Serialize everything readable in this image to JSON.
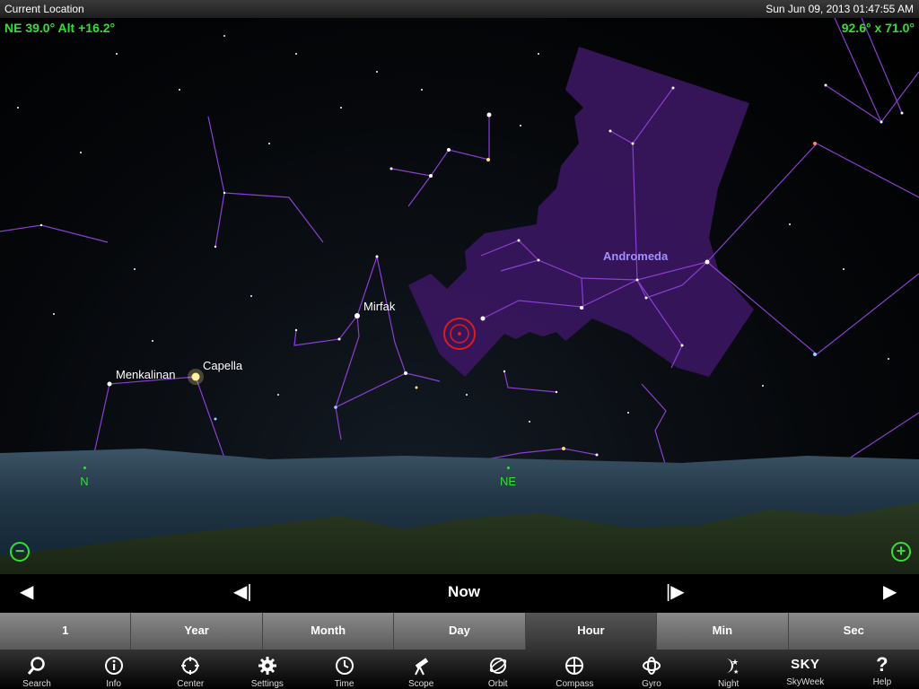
{
  "status": {
    "location": "Current Location",
    "datetime": "Sun Jun 09, 2013  01:47:55 AM"
  },
  "hud": {
    "pointing": "NE 39.0° Alt +16.2°",
    "fov": "92.6° x 71.0°"
  },
  "labels": {
    "andromeda": "Andromeda",
    "mirfak": "Mirfak",
    "capella": "Capella",
    "menkalinan": "Menkalinan"
  },
  "compass": {
    "north": "N",
    "northeast": "NE"
  },
  "zoom": {
    "out": "⊖",
    "in": "⊕"
  },
  "nav": {
    "back_far": "◀",
    "back_step": "◀|",
    "now": "Now",
    "fwd_step": "|▶",
    "fwd_far": "▶"
  },
  "steps": [
    {
      "label": "1"
    },
    {
      "label": "Year"
    },
    {
      "label": "Month"
    },
    {
      "label": "Day"
    },
    {
      "label": "Hour",
      "selected": true
    },
    {
      "label": "Min"
    },
    {
      "label": "Sec"
    }
  ],
  "toolbar": [
    {
      "label": "Search",
      "icon": "search-icon"
    },
    {
      "label": "Info",
      "icon": "info-icon"
    },
    {
      "label": "Center",
      "icon": "center-icon"
    },
    {
      "label": "Settings",
      "icon": "gear-icon"
    },
    {
      "label": "Time",
      "icon": "clock-icon"
    },
    {
      "label": "Scope",
      "icon": "telescope-icon"
    },
    {
      "label": "Orbit",
      "icon": "orbit-icon"
    },
    {
      "label": "Compass",
      "icon": "compass-icon"
    },
    {
      "label": "Gyro",
      "icon": "gyro-icon"
    },
    {
      "label": "Night",
      "icon": "night-icon"
    },
    {
      "label": "SkyWeek",
      "icon": "sky-logo",
      "logo_text": "SKY"
    },
    {
      "label": "Help",
      "icon": "help-icon",
      "glyph": "?"
    }
  ],
  "colors": {
    "hud_green": "#32e032",
    "constellation_line": "#8a3fd0",
    "andromeda_fill": "#3a1660",
    "target_ring": "#d81e1e"
  }
}
